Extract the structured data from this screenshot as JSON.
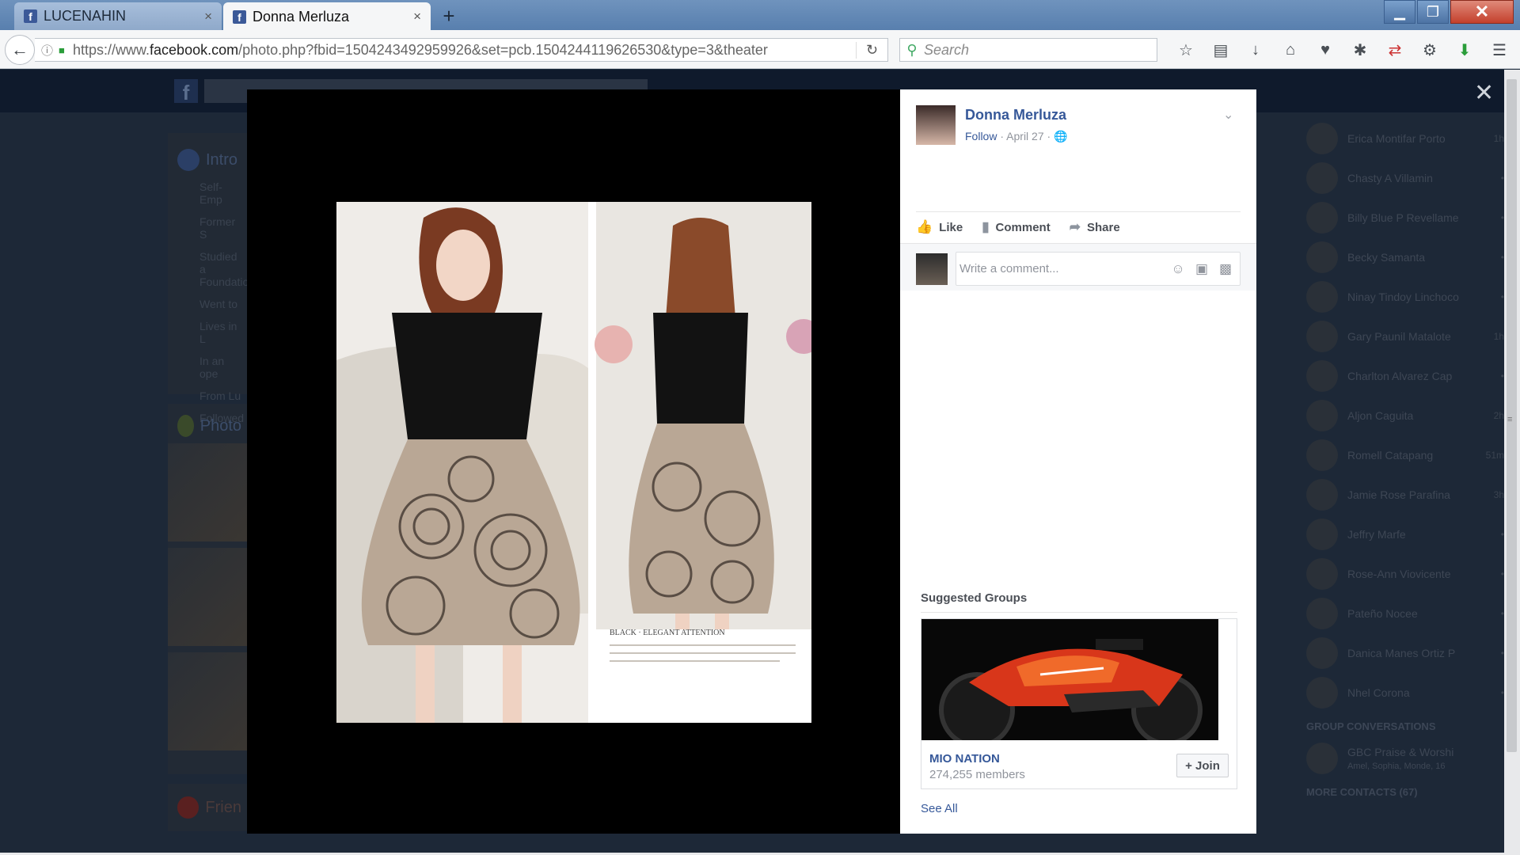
{
  "browser": {
    "tabs": [
      {
        "label": "LUCENAHIN",
        "close": "×"
      },
      {
        "label": "Donna Merluza",
        "close": "×"
      }
    ],
    "new_tab": "+",
    "window": {
      "minimize": "▁",
      "maximize": "❐",
      "close": "✕"
    },
    "url_prefix": "https://www.",
    "url_domain": "facebook.com",
    "url_path": "/photo.php?fbid=1504243492959926&set=pcb.1504244119626530&type=3&theater",
    "search_placeholder": "Search",
    "toolbar_icons": [
      "bookmark-star-icon",
      "reading-list-icon",
      "downloads-icon",
      "home-icon",
      "pocket-icon",
      "extension-icon",
      "sync-icon",
      "addon-icon",
      "download-green-icon",
      "menu-icon"
    ]
  },
  "post": {
    "author": "Donna Merluza",
    "follow": "Follow",
    "date": "April 27",
    "separator": "·",
    "caret": "⌄",
    "actions": {
      "like": "Like",
      "comment": "Comment",
      "share": "Share"
    },
    "comment_placeholder": "Write a comment...",
    "photo_caption_title": "BLACK · ELEGANT ATTENTION"
  },
  "suggested": {
    "title": "Suggested Groups",
    "group_name": "MIO NATION",
    "members": "274,255 members",
    "join": "+ Join",
    "see_all": "See All"
  },
  "background": {
    "intro": "Intro",
    "intro_rows": [
      "Self-Emp",
      "Former S",
      "Studied a Foundatio",
      "Went to",
      "Lives in L",
      "In an ope",
      "From Lu",
      "Followed"
    ],
    "photos": "Photo",
    "friends": "Frien",
    "contacts": [
      {
        "name": "Erica Montifar Porto",
        "status": "1h"
      },
      {
        "name": "Chasty A Villamin",
        "status": "•"
      },
      {
        "name": "Billy Blue P Revellame",
        "status": "•"
      },
      {
        "name": "Becky Samanta",
        "status": "•"
      },
      {
        "name": "Ninay Tindoy Linchoco",
        "status": "•"
      },
      {
        "name": "Gary Paunil Matalote",
        "status": "1h"
      },
      {
        "name": "Charlton Alvarez Cap",
        "status": "•"
      },
      {
        "name": "Aljon Caguita",
        "status": "2h"
      },
      {
        "name": "Romell Catapang",
        "status": "51m"
      },
      {
        "name": "Jamie Rose Parafina",
        "status": "3h"
      },
      {
        "name": "Jeffry Marfe",
        "status": "•"
      },
      {
        "name": "Rose-Ann Viovicente",
        "status": "•"
      },
      {
        "name": "Pateño Nocee",
        "status": "•"
      },
      {
        "name": "Danica Manes Ortiz P",
        "status": "•"
      },
      {
        "name": "Nhel Corona",
        "status": "•"
      }
    ],
    "group_conversations": "GROUP CONVERSATIONS",
    "group_convo": {
      "name": "GBC Praise & Worshi",
      "sub": "Amel, Sophia, Monde, 16"
    },
    "more_contacts": "MORE CONTACTS (67)"
  }
}
